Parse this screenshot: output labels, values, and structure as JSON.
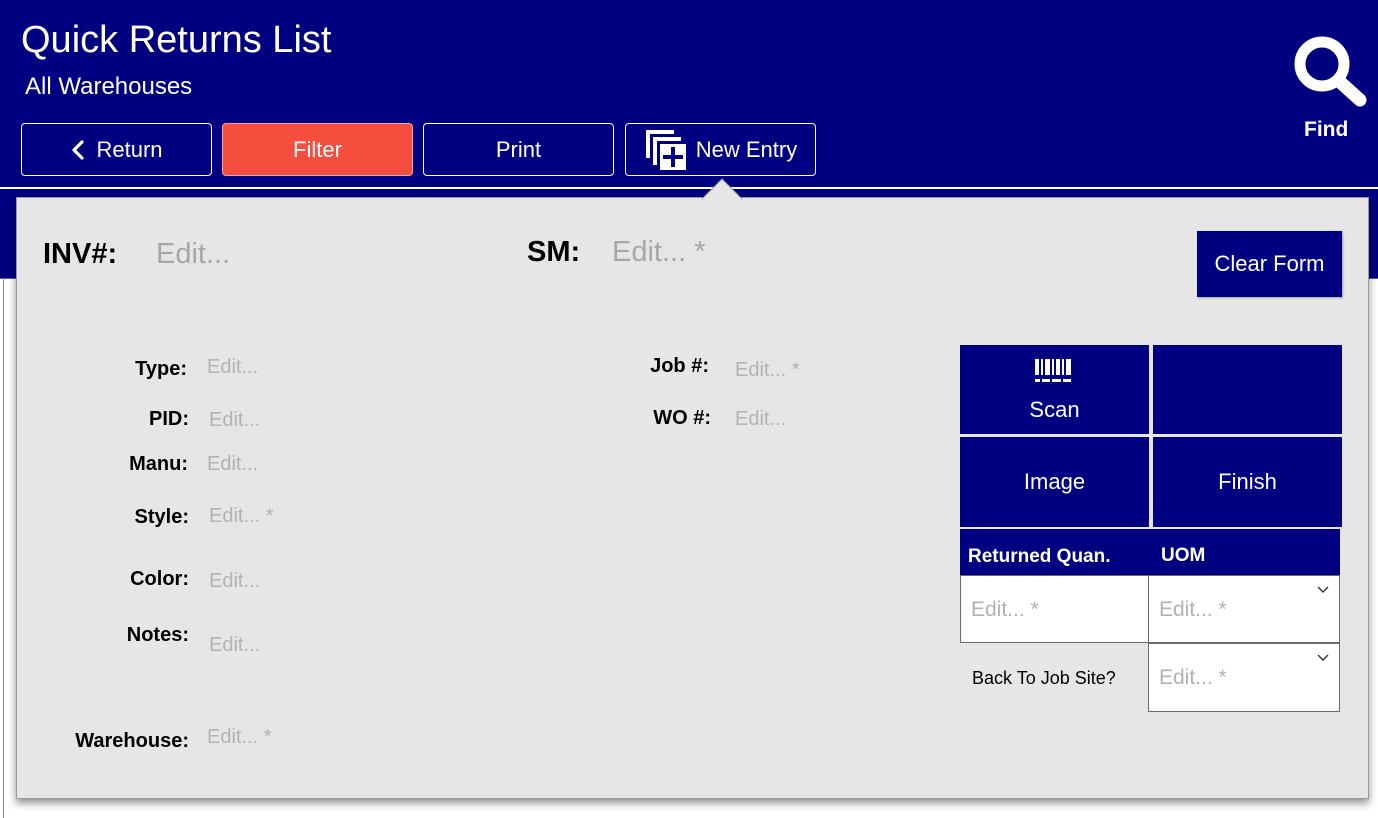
{
  "header": {
    "title": "Quick Returns List",
    "subtitle": "All Warehouses",
    "nav": {
      "return_label": "Return",
      "filter_label": "Filter",
      "print_label": "Print",
      "new_entry_label": "New Entry"
    },
    "find_label": "Find"
  },
  "form": {
    "inv_label": "INV#:",
    "inv_value": "Edit...",
    "sm_label": "SM:",
    "sm_value": "Edit... *",
    "clear_label": "Clear Form",
    "fields": {
      "type": {
        "label": "Type:",
        "value": "Edit..."
      },
      "pid": {
        "label": "PID:",
        "value": "Edit..."
      },
      "manu": {
        "label": "Manu:",
        "value": "Edit..."
      },
      "style": {
        "label": "Style:",
        "value": "Edit... *"
      },
      "color": {
        "label": "Color:",
        "value": "Edit..."
      },
      "notes": {
        "label": "Notes:",
        "value": "Edit..."
      },
      "warehouse": {
        "label": "Warehouse:",
        "value": "Edit... *"
      },
      "job": {
        "label": "Job #:",
        "value": "Edit... *"
      },
      "wo": {
        "label": "WO #:",
        "value": "Edit..."
      }
    },
    "actions": {
      "scan_label": "Scan",
      "image_label": "Image",
      "finish_label": "Finish"
    },
    "grid": {
      "returned_quan_header": "Returned Quan.",
      "uom_header": "UOM",
      "returned_quan_value": "Edit... *",
      "uom_value": "Edit... *",
      "back_to_job_label": "Back To Job Site?",
      "back_to_job_value": "Edit... *"
    }
  },
  "colors": {
    "brand_navy": "#000080",
    "filter_active": "#f54e3f",
    "panel_bg": "#e6e6e6",
    "placeholder": "#b2b2b2"
  }
}
